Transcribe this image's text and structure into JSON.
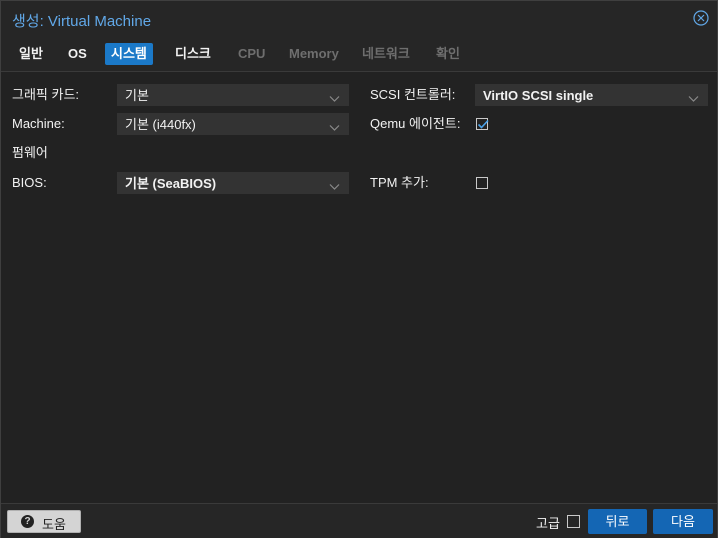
{
  "window": {
    "title": "생성: Virtual Machine"
  },
  "tabs": [
    {
      "label": "일반"
    },
    {
      "label": "OS"
    },
    {
      "label": "시스템"
    },
    {
      "label": "디스크"
    },
    {
      "label": "CPU"
    },
    {
      "label": "Memory"
    },
    {
      "label": "네트워크"
    },
    {
      "label": "확인"
    }
  ],
  "form": {
    "graphics_card": {
      "label": "그래픽 카드:",
      "value": "기본"
    },
    "machine": {
      "label": "Machine:",
      "value": "기본 (i440fx)"
    },
    "firmware_heading": "펌웨어",
    "bios": {
      "label": "BIOS:",
      "value": "기본 (SeaBIOS)"
    },
    "scsi_controller": {
      "label": "SCSI 컨트롤러:",
      "value": "VirtIO SCSI single"
    },
    "qemu_agent": {
      "label": "Qemu 에이전트:",
      "checked": true
    },
    "tpm": {
      "label": "TPM 추가:",
      "checked": false
    }
  },
  "footer": {
    "help_label": "도움",
    "advanced_label": "고급",
    "back_label": "뒤로",
    "next_label": "다음"
  },
  "colors": {
    "accent": "#1b79c8",
    "title": "#61a8e8",
    "button_primary": "#1466b4"
  }
}
